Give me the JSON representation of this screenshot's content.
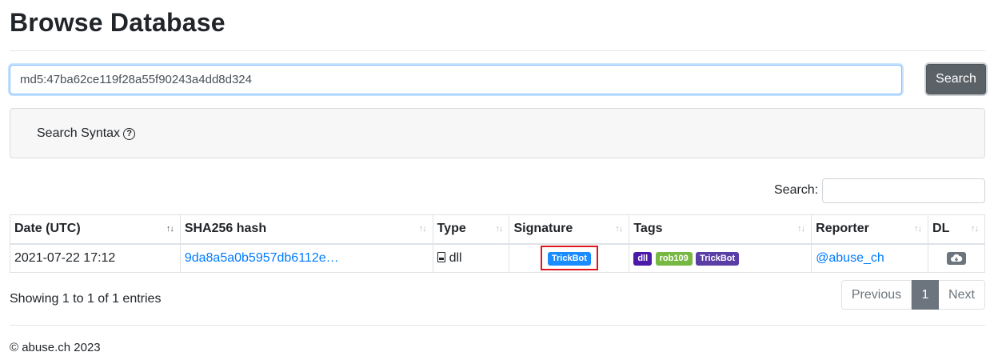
{
  "page": {
    "title": "Browse Database"
  },
  "search": {
    "query": "md5:47ba62ce119f28a55f90243a4dd8d324",
    "button_label": "Search"
  },
  "syntax": {
    "label": "Search Syntax",
    "help_glyph": "?"
  },
  "table_filter": {
    "label": "Search:",
    "value": ""
  },
  "table": {
    "columns": [
      "Date (UTC)",
      "SHA256 hash",
      "Type",
      "Signature",
      "Tags",
      "Reporter",
      "DL"
    ],
    "sort_glyph": "↑↓",
    "rows": [
      {
        "date": "2021-07-22 17:12",
        "sha256": "9da8a5a0b5957db6112e…",
        "type": "dll",
        "signature": "TrickBot",
        "tags": [
          "dll",
          "rob109",
          "TrickBot"
        ],
        "reporter": "@abuse_ch",
        "dl_icon": "cloud-download-icon"
      }
    ]
  },
  "pagination": {
    "info": "Showing 1 to 1 of 1 entries",
    "previous": "Previous",
    "current": "1",
    "next": "Next"
  },
  "footer": {
    "text": "© abuse.ch 2023"
  },
  "colors": {
    "signature_badge": "#1a8cff",
    "tag_dll": "#4b1aa8",
    "tag_rob109": "#77b843",
    "tag_trickbot": "#5a3ea6",
    "highlight_box": "#e0161e",
    "button": "#5a6268",
    "link": "#007bff"
  }
}
